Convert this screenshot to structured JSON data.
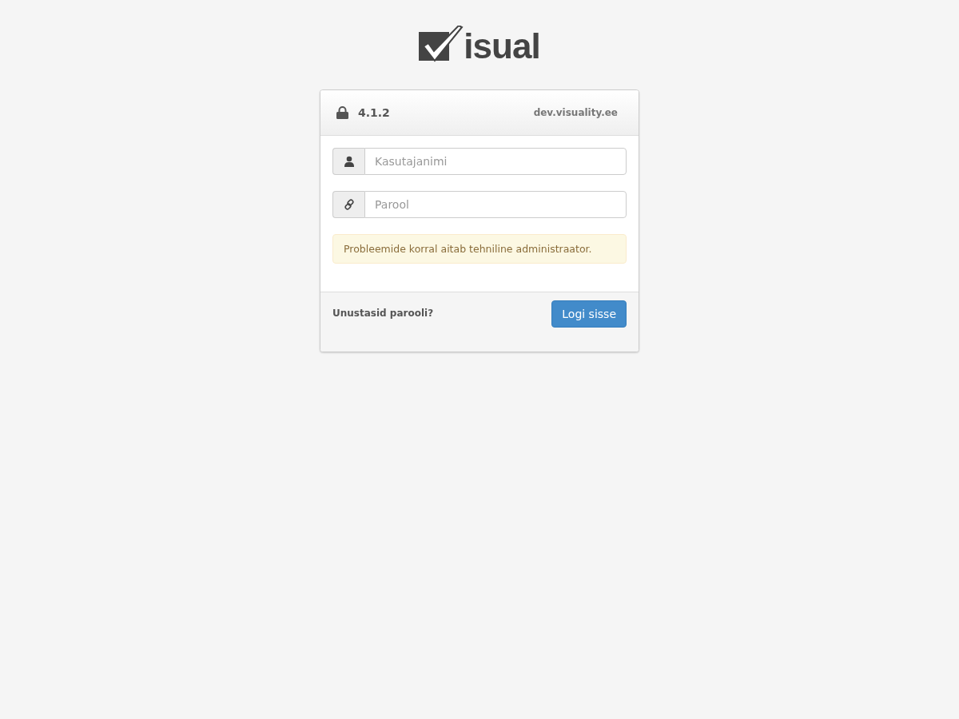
{
  "logo": {
    "text": "isual"
  },
  "header": {
    "version": "4.1.2",
    "host": "dev.visuality.ee"
  },
  "fields": [
    {
      "kind": "user",
      "placeholder": "Kasutajanimi"
    },
    {
      "kind": "link",
      "placeholder": "Parool"
    }
  ],
  "notice": "Probleemide korral aitab tehniline administraator.",
  "footer": {
    "link": "Unustasid parooli?",
    "button": "Logi sisse"
  }
}
